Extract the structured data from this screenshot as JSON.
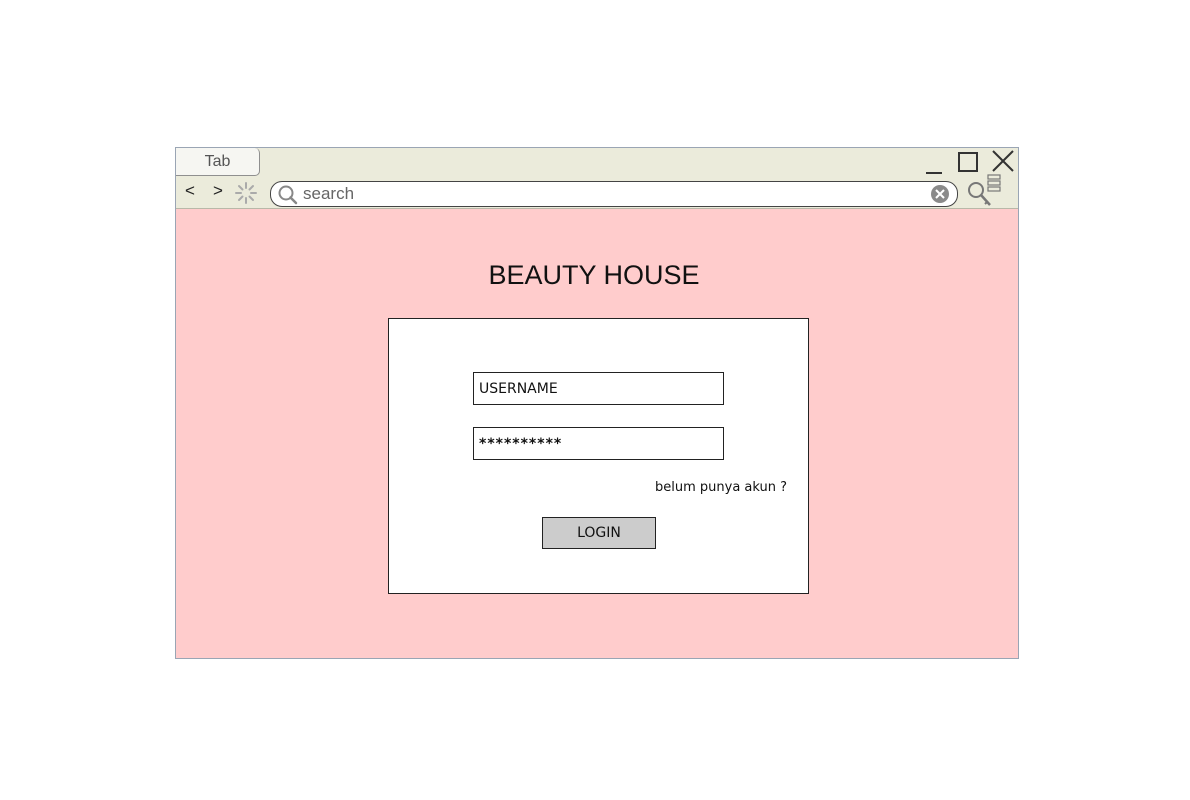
{
  "browser": {
    "tab_label": "Tab",
    "back_label": "<",
    "forward_label": ">",
    "search_placeholder": "search"
  },
  "page": {
    "title": "BEAUTY HOUSE"
  },
  "login": {
    "username_value": "USERNAME",
    "password_value": "**********",
    "register_link": "belum punya akun ?",
    "login_button": "LOGIN"
  },
  "colors": {
    "page_background": "#ffcccc",
    "chrome_background": "#ebebdb",
    "button_background": "#cccccc"
  }
}
